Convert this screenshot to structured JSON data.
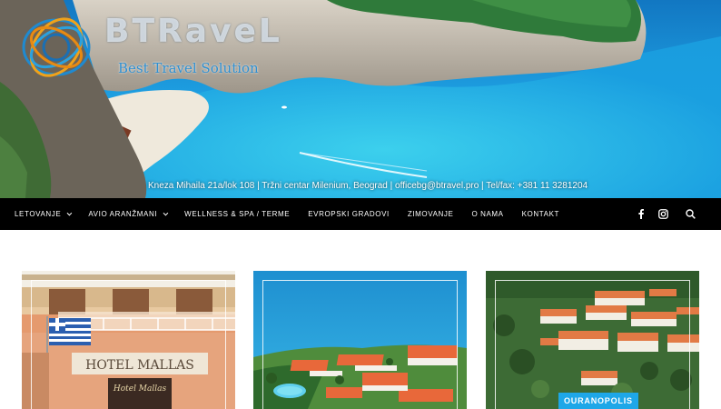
{
  "brand": {
    "name": "BTRaveL",
    "tagline": "Best Travel Solution"
  },
  "contact": {
    "address": "Kneza Mihaila 21a/lok 108",
    "center": "Tržni centar Milenium, Beograd",
    "email": "officebg@btravel.pro",
    "phone": "Tel/fax: +381 11 3281204",
    "separator": " | "
  },
  "nav": {
    "items": [
      {
        "label": "LETOVANJE",
        "has_dropdown": true
      },
      {
        "label": "AVIO ARANŽMANI",
        "has_dropdown": true
      },
      {
        "label": "WELLNESS & SPA / TERME",
        "has_dropdown": false
      },
      {
        "label": "EVROPSKI GRADOVI",
        "has_dropdown": false
      },
      {
        "label": "ZIMOVANJE",
        "has_dropdown": false
      },
      {
        "label": "O NAMA",
        "has_dropdown": false
      },
      {
        "label": "KONTAKT",
        "has_dropdown": false
      }
    ],
    "icons": [
      "facebook-icon",
      "instagram-icon",
      "search-icon"
    ]
  },
  "cards": [
    {
      "image_text": "HOTEL MALLAS",
      "sign_text": "Hotel Mallas",
      "badge": ""
    },
    {
      "image_text": "",
      "badge": ""
    },
    {
      "image_text": "",
      "badge": "OURANOPOLIS"
    }
  ],
  "colors": {
    "nav_bg": "#000000",
    "accent": "#1ea7e8",
    "sea": "#1aa6e0",
    "tagline": "#2f8fd0"
  }
}
